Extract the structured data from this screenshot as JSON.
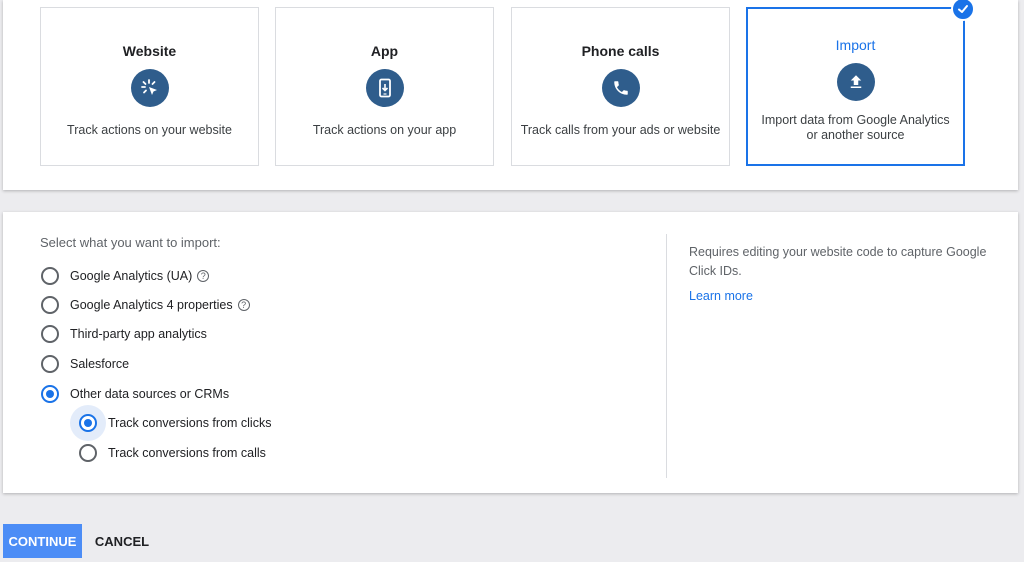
{
  "cards": [
    {
      "title": "Website",
      "description": "Track actions on your website",
      "icon": "cursor-click-icon"
    },
    {
      "title": "App",
      "description": "Track actions on your app",
      "icon": "mobile-app-icon"
    },
    {
      "title": "Phone calls",
      "description": "Track calls from your ads or website",
      "icon": "phone-icon"
    },
    {
      "title": "Import",
      "description": "Import data from Google Analytics or another source",
      "icon": "upload-icon",
      "selected": true
    }
  ],
  "import_section": {
    "prompt": "Select what you want to import:",
    "options": [
      {
        "label": "Google Analytics (UA)",
        "help": "?",
        "checked": false
      },
      {
        "label": "Google Analytics 4 properties",
        "help": "?",
        "checked": false
      },
      {
        "label": "Third-party app analytics",
        "checked": false
      },
      {
        "label": "Salesforce",
        "checked": false
      },
      {
        "label": "Other data sources or CRMs",
        "checked": true
      }
    ],
    "sub_options": [
      {
        "label": "Track conversions from clicks",
        "checked": true
      },
      {
        "label": "Track conversions from calls",
        "checked": false
      }
    ],
    "side_text": "Requires editing your website code to capture Google Click IDs.",
    "learn_more": "Learn more"
  },
  "actions": {
    "continue_label": "CONTINUE",
    "cancel_label": "CANCEL"
  },
  "colors": {
    "accent": "#1a73e8",
    "icon_circle": "#2f5d8c",
    "continue_bg": "#4c8df6"
  }
}
